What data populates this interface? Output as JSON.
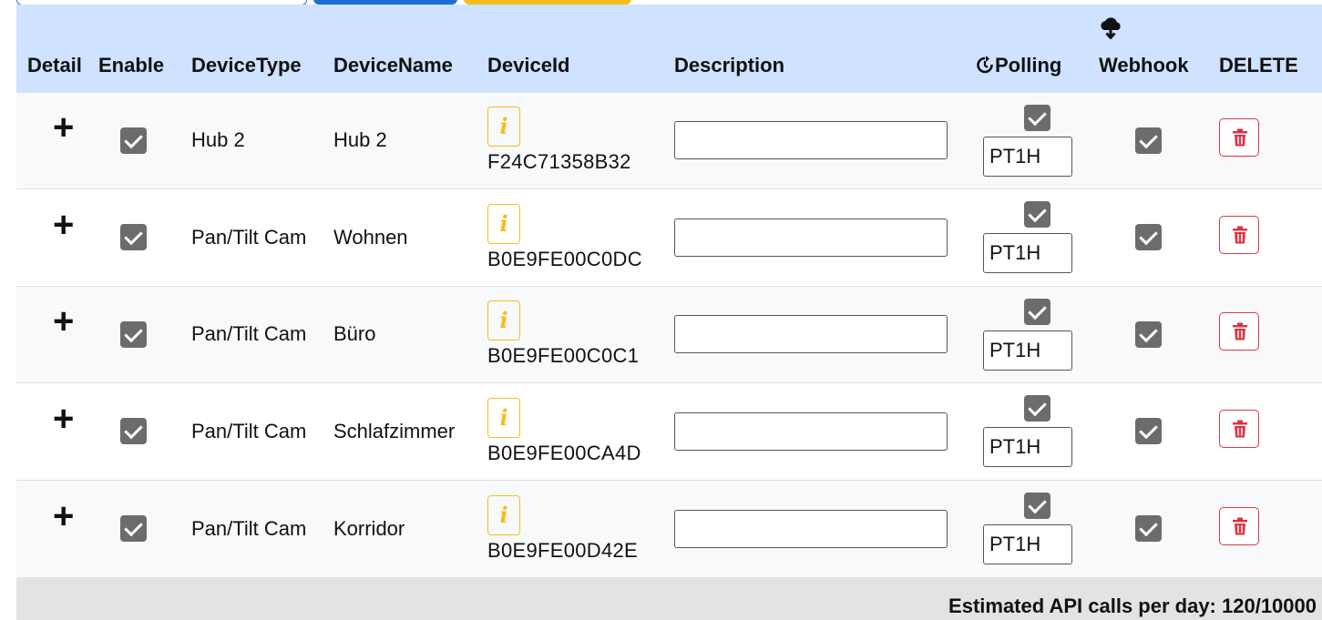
{
  "table": {
    "headers": {
      "detail": "Detail",
      "enable": "Enable",
      "device_type": "DeviceType",
      "device_name": "DeviceName",
      "device_id": "DeviceId",
      "description": "Description",
      "polling": "Polling",
      "webhook": "Webhook",
      "delete": "DELETE"
    },
    "rows": [
      {
        "device_type": "Hub 2",
        "device_name": "Hub 2",
        "device_id": "F24C71358B32",
        "description": "",
        "polling_interval": "PT1H",
        "enabled": true,
        "polling_enabled": true,
        "webhook_enabled": true
      },
      {
        "device_type": "Pan/Tilt Cam",
        "device_name": "Wohnen",
        "device_id": "B0E9FE00C0DC",
        "description": "",
        "polling_interval": "PT1H",
        "enabled": true,
        "polling_enabled": true,
        "webhook_enabled": true
      },
      {
        "device_type": "Pan/Tilt Cam",
        "device_name": "Büro",
        "device_id": "B0E9FE00C0C1",
        "description": "",
        "polling_interval": "PT1H",
        "enabled": true,
        "polling_enabled": true,
        "webhook_enabled": true
      },
      {
        "device_type": "Pan/Tilt Cam",
        "device_name": "Schlafzimmer",
        "device_id": "B0E9FE00CA4D",
        "description": "",
        "polling_interval": "PT1H",
        "enabled": true,
        "polling_enabled": true,
        "webhook_enabled": true
      },
      {
        "device_type": "Pan/Tilt Cam",
        "device_name": "Korridor",
        "device_id": "B0E9FE00D42E",
        "description": "",
        "polling_interval": "PT1H",
        "enabled": true,
        "polling_enabled": true,
        "webhook_enabled": true
      }
    ]
  },
  "footer": {
    "estimate": "Estimated API calls per day: 120/10000"
  },
  "icons": {
    "detail": "plus-icon",
    "info": "info-icon",
    "polling": "refresh-icon",
    "webhook": "cloud-upload-icon",
    "delete": "trash-icon"
  },
  "colors": {
    "header_bg": "#cfe2ff",
    "info": "#f5bd1a",
    "danger": "#dc3545",
    "checkbox": "#6c6c6c",
    "footer_bg": "#e2e3e5"
  }
}
